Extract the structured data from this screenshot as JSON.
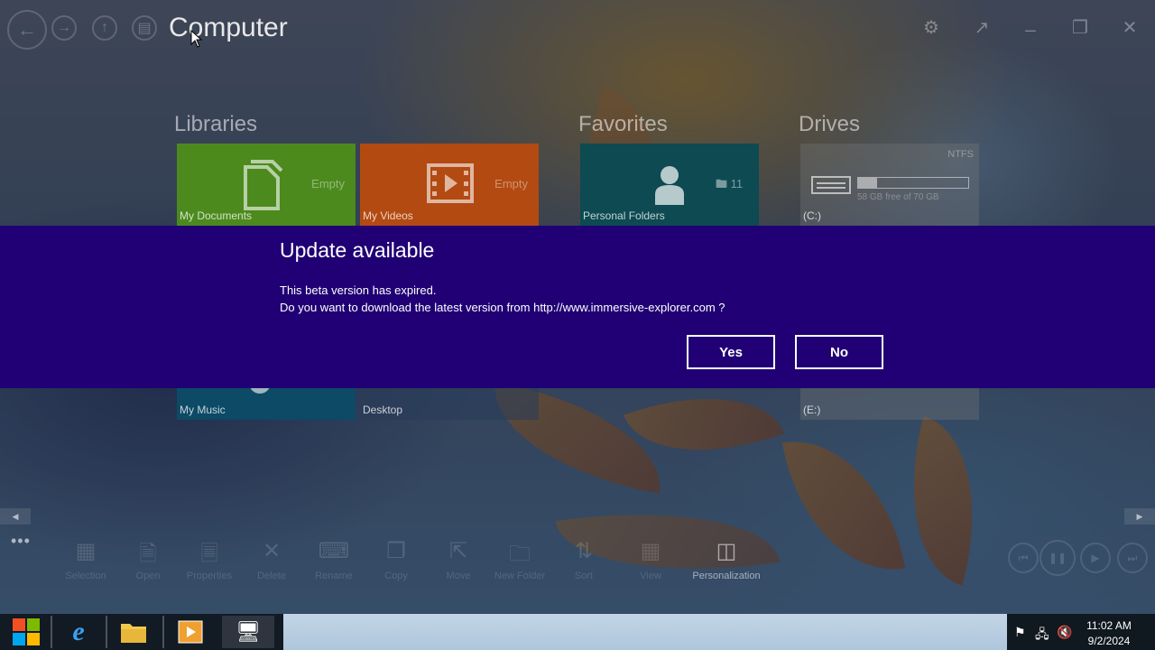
{
  "window": {
    "title": "Computer",
    "nav": {
      "back_icon": "arrow-left-icon",
      "forward_icon": "arrow-right-icon",
      "up_icon": "arrow-up-icon",
      "view_icon": "monitor-icon"
    },
    "controls": {
      "settings": "gear-icon",
      "popout": "popout-icon",
      "minimize": "minimize-icon",
      "restore": "restore-icon",
      "close": "close-icon"
    }
  },
  "sections": {
    "libraries": "Libraries",
    "favorites": "Favorites",
    "drives": "Drives"
  },
  "tiles": {
    "my_documents": {
      "label": "My Documents",
      "status": "Empty",
      "color": "#4c8a1e"
    },
    "my_videos": {
      "label": "My Videos",
      "status": "Empty",
      "color": "#b24a12"
    },
    "personal_folders": {
      "label": "Personal Folders",
      "count": "11",
      "color": "#0d4a52"
    },
    "drive_c": {
      "label": "(C:)",
      "fs": "NTFS",
      "free": "58 GB free of 70 GB",
      "used_fraction": 0.17
    },
    "my_music": {
      "label": "My Music",
      "color": "#0c4a66"
    },
    "desktop": {
      "label": "Desktop"
    },
    "drive_e": {
      "label": "(E:)"
    }
  },
  "dialog": {
    "title": "Update available",
    "line1": "This beta version has expired.",
    "line2": "Do you want to download the latest version from http://www.immersive-explorer.com ?",
    "yes": "Yes",
    "no": "No",
    "background": "#200074"
  },
  "appbar": {
    "more": "•••",
    "commands": [
      "Selection",
      "Open",
      "Properties",
      "Delete",
      "Rename",
      "Copy",
      "Move",
      "New Folder",
      "Sort",
      "View",
      "Personalization"
    ]
  },
  "taskbar": {
    "time": "11:02 AM",
    "date": "9/2/2024"
  }
}
